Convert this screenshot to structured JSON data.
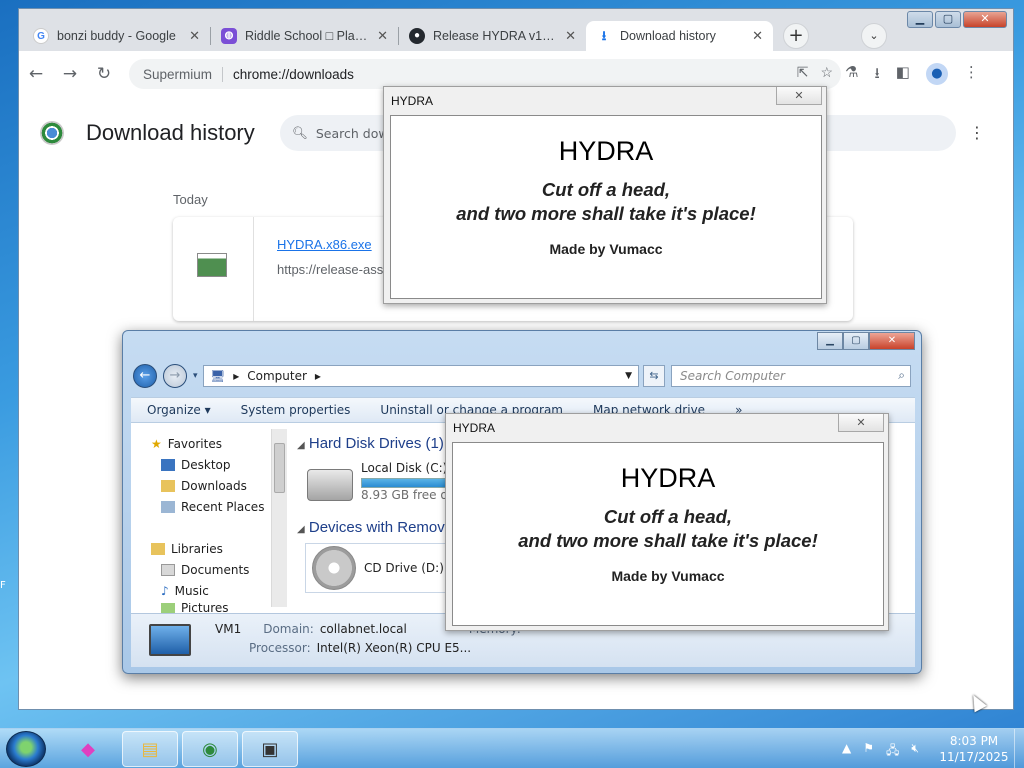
{
  "browser": {
    "tabs": [
      {
        "label": "bonzi buddy - Google",
        "icon": "google-icon"
      },
      {
        "label": "Riddle School □ Play c",
        "icon": "riddle-school-icon"
      },
      {
        "label": "Release HYDRA v1.1 ·",
        "icon": "github-icon"
      },
      {
        "label": "Download history",
        "icon": "download-icon",
        "active": true
      }
    ],
    "omnibox": {
      "site": "Supermium",
      "url": "chrome://downloads"
    }
  },
  "downloads_page": {
    "title": "Download history",
    "search_placeholder": "Search downloads",
    "section": "Today",
    "items": [
      {
        "file_name": "HYDRA.x86.exe",
        "url": "https://release-ass"
      }
    ]
  },
  "hydra_dialog": {
    "caption": "HYDRA",
    "close_symbol": "✕",
    "heading": "HYDRA",
    "line1": "Cut off a head,",
    "line2": "and two more shall take it's place!",
    "credit": "Made by Vumacc"
  },
  "explorer": {
    "address": "Computer",
    "search_placeholder": "Search Computer",
    "commands": [
      "Organize ▾",
      "System properties",
      "Uninstall or change a program",
      "Map network drive",
      "»"
    ],
    "nav": {
      "favorites": "Favorites",
      "desktop": "Desktop",
      "downloads": "Downloads",
      "recent": "Recent Places",
      "libraries": "Libraries",
      "documents": "Documents",
      "music": "Music",
      "pictures": "Pictures"
    },
    "groups": {
      "hdd": "Hard Disk Drives (1)",
      "removable": "Devices with Removable Storage"
    },
    "drives": {
      "c_name": "Local Disk (C:)",
      "c_free": "8.93 GB free of 5",
      "d_name": "CD Drive (D:)"
    },
    "details": {
      "computer_name": "VM1",
      "domain_label": "Domain:",
      "domain_value": "collabnet.local",
      "memory_label": "Memory:",
      "processor_label": "Processor:",
      "processor_value": "Intel(R) Xeon(R) CPU E5..."
    }
  },
  "taskbar": {
    "time": "8:03 PM",
    "date": "11/17/2025"
  },
  "colors": {
    "accent": "#1a73e8",
    "explorer_group": "#1e3f8a"
  }
}
